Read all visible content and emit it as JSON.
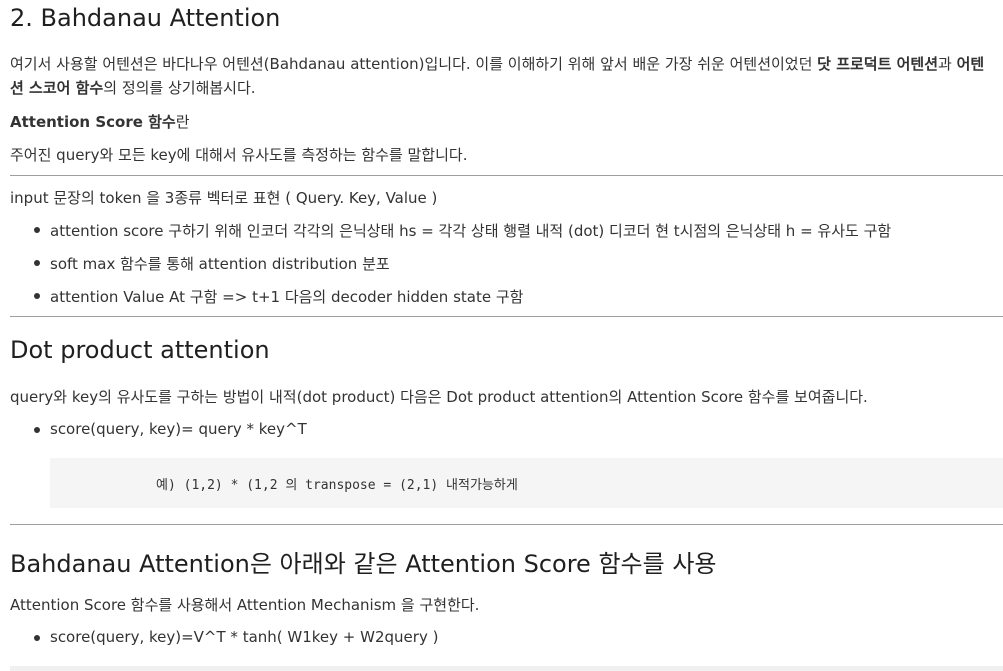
{
  "section2": {
    "title": "2. Bahdanau Attention",
    "intro_part1": "여기서 사용할 어텐션은 바다나우 어텐션(Bahdanau attention)입니다. 이를 이해하기 위해 앞서 배운 가장 쉬운 어텐션이었던 ",
    "intro_bold1": "닷 프로덕트 어텐션",
    "intro_part2": "과 ",
    "intro_bold2": "어텐션 스코어 함수",
    "intro_part3": "의 정의를 상기해봅시다.",
    "score_fn_heading_bold": "Attention Score 함수",
    "score_fn_heading_rest": "란",
    "score_fn_desc": "주어진 query와 모든 key에 대해서 유사도를 측정하는 함수를 말합니다.",
    "input_line": "input 문장의 token 을 3종류 벡터로 표현 ( Query. Key, Value )",
    "bullets": [
      "attention score 구하기 위해 인코더 각각의 은닉상태 hs = 각각 상태 행렬 내적 (dot) 디코더 현 t시점의 은닉상태 h = 유사도 구함",
      "soft max 함수를 통해 attention distribution 분포",
      "attention Value At 구함 => t+1 다음의 decoder hidden state 구함"
    ]
  },
  "dot_product": {
    "title": "Dot product attention",
    "desc": "query와 key의 유사도를 구하는 방법이 내적(dot product) 다음은 Dot product attention의 Attention Score 함수를 보여줍니다.",
    "bullet": "score(query, key)= query * key^T",
    "code": "예) (1,2) * (1,2 의 transpose = (2,1) 내적가능하게"
  },
  "bahdanau_score": {
    "title": "Bahdanau Attention은 아래와 같은 Attention Score 함수를 사용",
    "desc": "Attention Score 함수를 사용해서 Attention Mechanism 을 구현한다.",
    "bullet": "score(query, key)=V^T * tanh( W1key + W2query )"
  }
}
